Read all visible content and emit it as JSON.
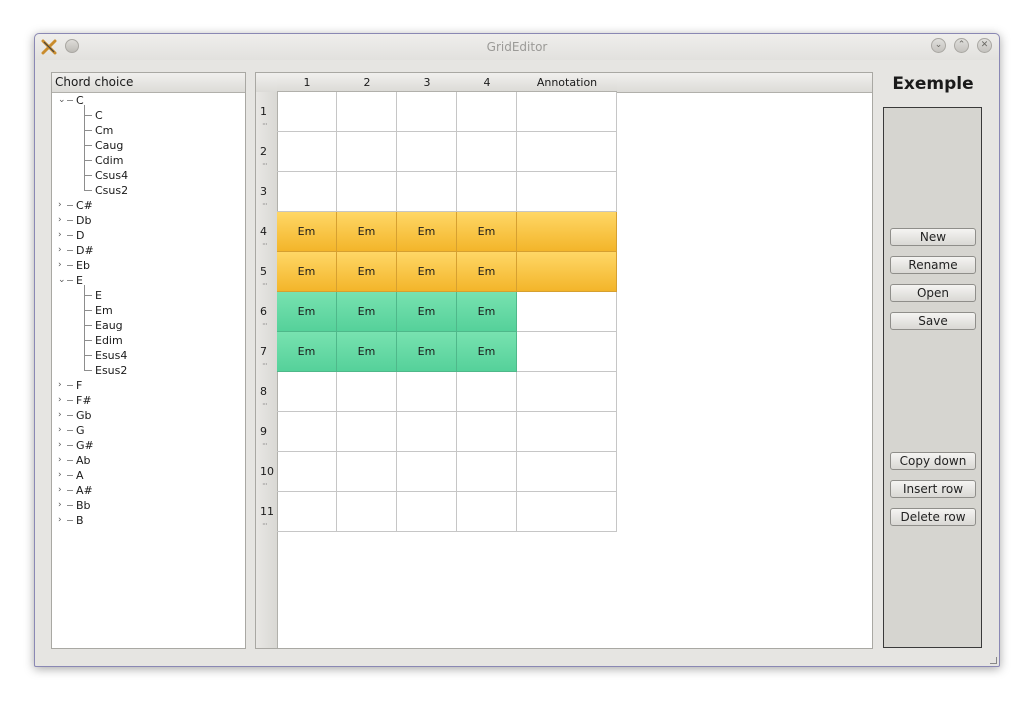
{
  "window": {
    "title": "GridEditor"
  },
  "chord_panel": {
    "header": "Chord choice",
    "tree": [
      {
        "label": "C",
        "expanded": true,
        "children": [
          "C",
          "Cm",
          "Caug",
          "Cdim",
          "Csus4",
          "Csus2"
        ]
      },
      {
        "label": "C#",
        "expanded": false
      },
      {
        "label": "Db",
        "expanded": false
      },
      {
        "label": "D",
        "expanded": false
      },
      {
        "label": "D#",
        "expanded": false
      },
      {
        "label": "Eb",
        "expanded": false
      },
      {
        "label": "E",
        "expanded": true,
        "children": [
          "E",
          "Em",
          "Eaug",
          "Edim",
          "Esus4",
          "Esus2"
        ]
      },
      {
        "label": "F",
        "expanded": false
      },
      {
        "label": "F#",
        "expanded": false
      },
      {
        "label": "Gb",
        "expanded": false
      },
      {
        "label": "G",
        "expanded": false
      },
      {
        "label": "G#",
        "expanded": false
      },
      {
        "label": "Ab",
        "expanded": false
      },
      {
        "label": "A",
        "expanded": false
      },
      {
        "label": "A#",
        "expanded": false
      },
      {
        "label": "Bb",
        "expanded": false
      },
      {
        "label": "B",
        "expanded": false
      }
    ]
  },
  "grid": {
    "columns": [
      "1",
      "2",
      "3",
      "4",
      "Annotation"
    ],
    "row_dots": "···",
    "rows": [
      {
        "label": "1",
        "cells": [
          "",
          "",
          "",
          "",
          ""
        ],
        "color": ""
      },
      {
        "label": "2",
        "cells": [
          "",
          "",
          "",
          "",
          ""
        ],
        "color": ""
      },
      {
        "label": "3",
        "cells": [
          "",
          "",
          "",
          "",
          ""
        ],
        "color": ""
      },
      {
        "label": "4",
        "cells": [
          "Em",
          "Em",
          "Em",
          "Em",
          ""
        ],
        "color": "yellow",
        "colored_cells": 5
      },
      {
        "label": "5",
        "cells": [
          "Em",
          "Em",
          "Em",
          "Em",
          ""
        ],
        "color": "yellow",
        "colored_cells": 5
      },
      {
        "label": "6",
        "cells": [
          "Em",
          "Em",
          "Em",
          "Em",
          ""
        ],
        "color": "green",
        "colored_cells": 4
      },
      {
        "label": "7",
        "cells": [
          "Em",
          "Em",
          "Em",
          "Em",
          ""
        ],
        "color": "green",
        "colored_cells": 4
      },
      {
        "label": "8",
        "cells": [
          "",
          "",
          "",
          "",
          ""
        ],
        "color": ""
      },
      {
        "label": "9",
        "cells": [
          "",
          "",
          "",
          "",
          ""
        ],
        "color": ""
      },
      {
        "label": "10",
        "cells": [
          "",
          "",
          "",
          "",
          ""
        ],
        "color": ""
      },
      {
        "label": "11",
        "cells": [
          "",
          "",
          "",
          "",
          ""
        ],
        "color": ""
      }
    ],
    "colors": {
      "yellow": "#f7c443",
      "green": "#62d9a3"
    }
  },
  "sidebar": {
    "title": "Exemple",
    "buttons_top": [
      "New",
      "Rename",
      "Open",
      "Save"
    ],
    "buttons_bottom": [
      "Copy down",
      "Insert row",
      "Delete row"
    ]
  }
}
